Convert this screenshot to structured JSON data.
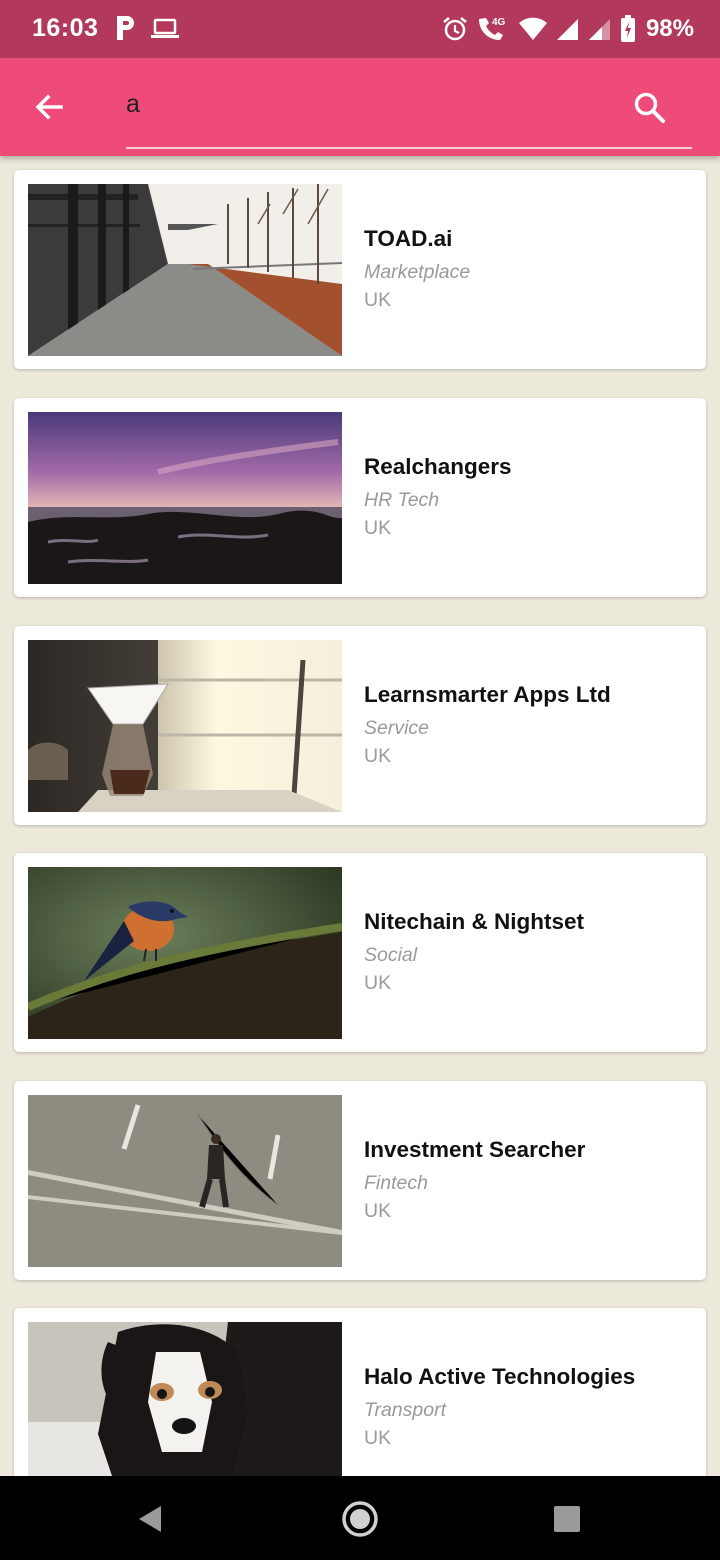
{
  "status_bar": {
    "time": "16:03",
    "battery": "98%",
    "network": "4G",
    "icons": [
      "parking-icon",
      "laptop-icon",
      "alarm-icon",
      "wifi-calling-icon",
      "wifi-icon",
      "signal-icon",
      "signal-icon-2",
      "battery-icon"
    ]
  },
  "app_bar": {
    "back_icon": "arrow-left-icon",
    "search_value": "a",
    "search_icon": "search-icon",
    "color": "#ee4b78"
  },
  "results": [
    {
      "title": "TOAD.ai",
      "category": "Marketplace",
      "location": "UK",
      "image": "walkway-photo"
    },
    {
      "title": "Realchangers",
      "category": "HR Tech",
      "location": "UK",
      "image": "seascape-sunset-photo"
    },
    {
      "title": "Learnsmarter Apps Ltd",
      "category": "Service",
      "location": "UK",
      "image": "coffee-maker-photo"
    },
    {
      "title": "Nitechain & Nightset",
      "category": "Social",
      "location": "UK",
      "image": "bird-photo"
    },
    {
      "title": "Investment Searcher",
      "category": "Fintech",
      "location": "UK",
      "image": "man-walking-photo"
    },
    {
      "title": "Halo Active Technologies",
      "category": "Transport",
      "location": "UK",
      "image": "puppy-photo"
    }
  ],
  "nav_bar": {
    "icons": [
      "back-triangle-icon",
      "home-circle-icon",
      "recents-square-icon"
    ]
  },
  "colors": {
    "status_bar": "#b2395b",
    "app_bar": "#ee4b78",
    "background": "#ece8da"
  }
}
